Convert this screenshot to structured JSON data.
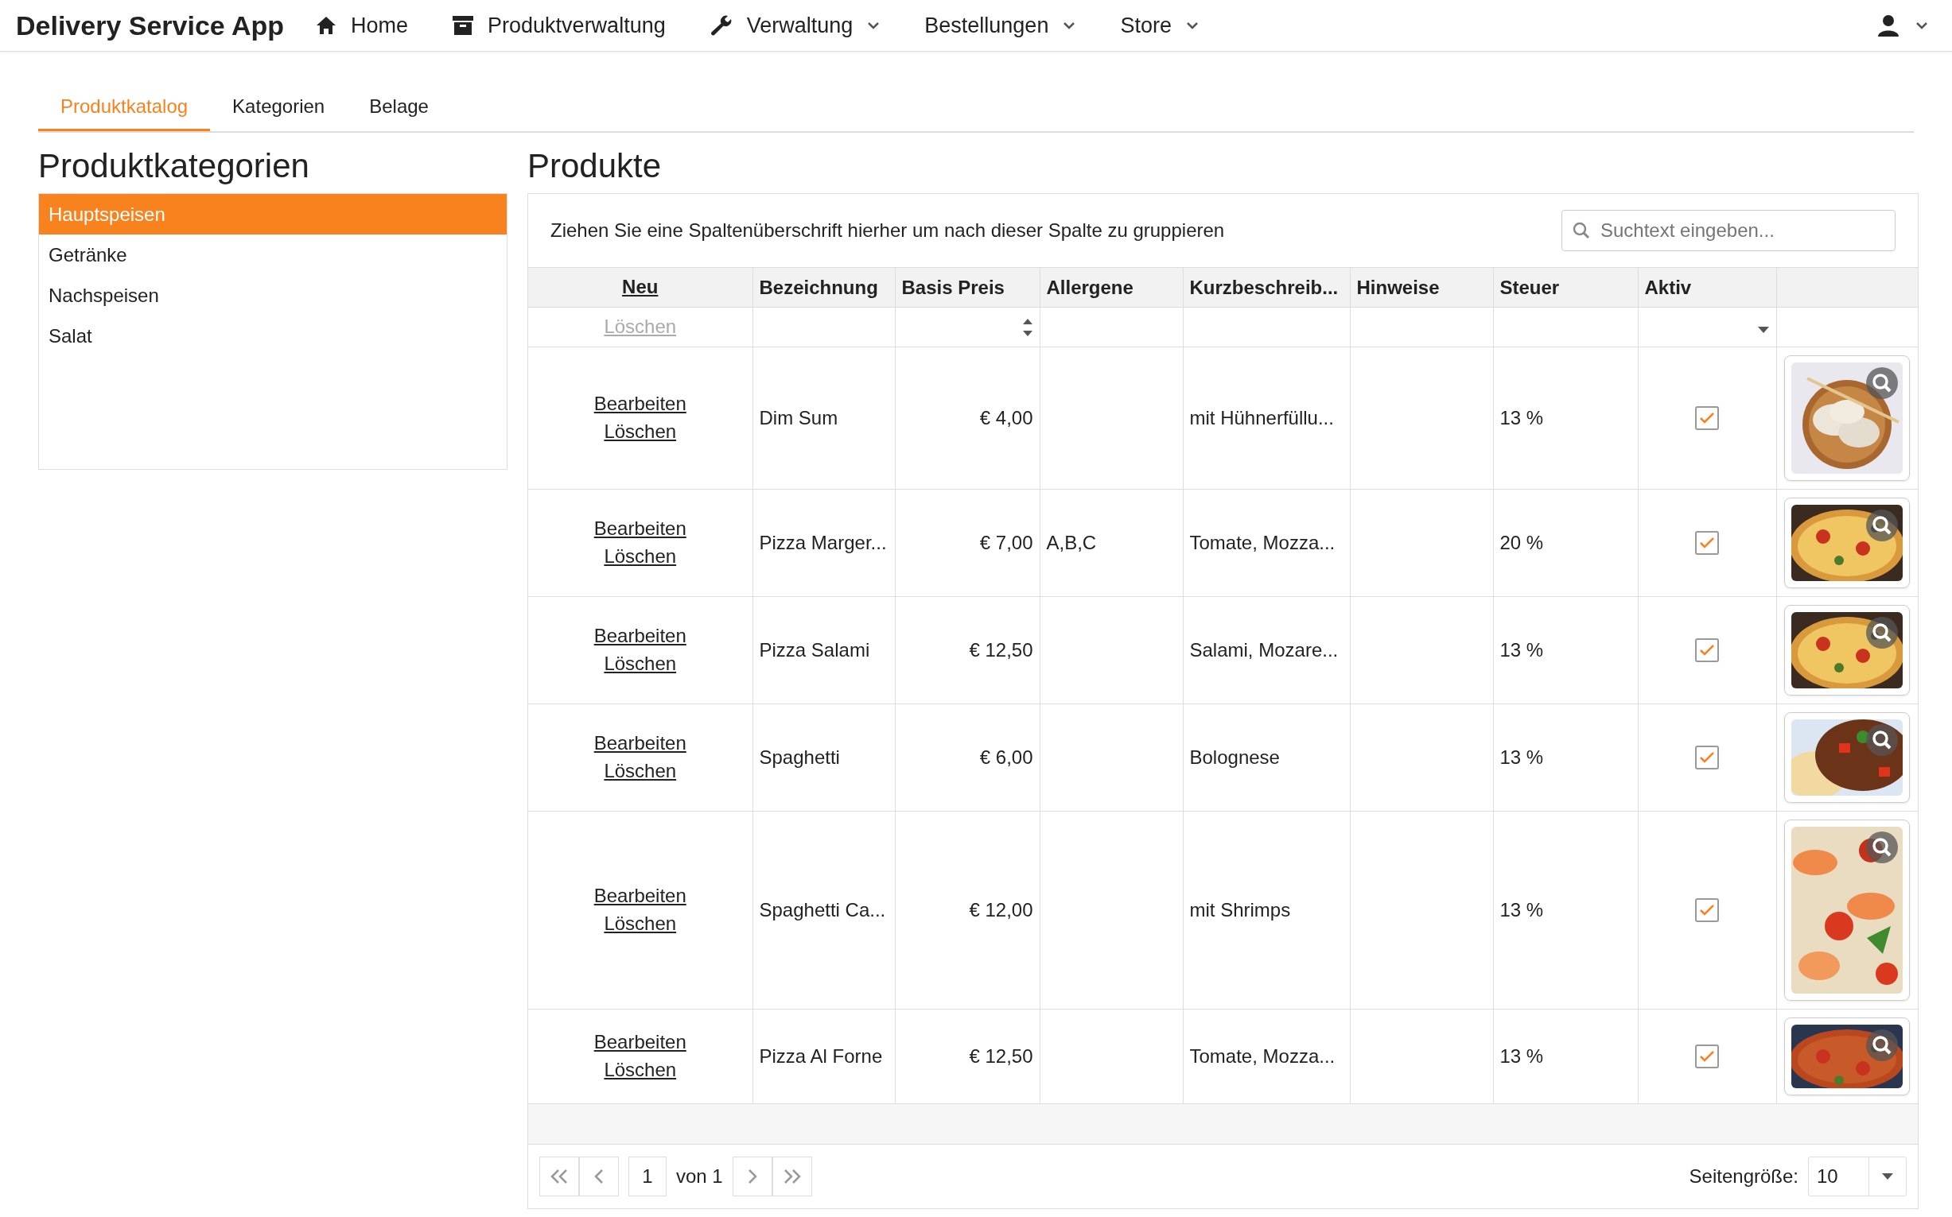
{
  "app_title": "Delivery Service App",
  "nav": [
    {
      "label": "Home",
      "dropdown": false
    },
    {
      "label": "Produktverwaltung",
      "dropdown": false
    },
    {
      "label": "Verwaltung",
      "dropdown": true
    },
    {
      "label": "Bestellungen",
      "dropdown": true
    },
    {
      "label": "Store",
      "dropdown": true
    }
  ],
  "tabs": [
    {
      "label": "Produktkatalog",
      "selected": true
    },
    {
      "label": "Kategorien",
      "selected": false
    },
    {
      "label": "Belage",
      "selected": false
    }
  ],
  "categories": {
    "title": "Produktkategorien",
    "items": [
      {
        "label": "Hauptspeisen",
        "selected": true
      },
      {
        "label": "Getränke",
        "selected": false
      },
      {
        "label": "Nachspeisen",
        "selected": false
      },
      {
        "label": "Salat",
        "selected": false
      }
    ]
  },
  "products": {
    "title": "Produkte",
    "group_hint": "Ziehen Sie eine Spaltenüberschrift hierher um nach dieser Spalte zu gruppieren",
    "search": {
      "placeholder": "Suchtext eingeben..."
    },
    "new_link": "Neu",
    "filter_delete": {
      "label": "Löschen",
      "disabled": true
    },
    "columns": [
      "Bezeichnung",
      "Basis Preis",
      "Allergene",
      "Kurzbeschreib...",
      "Hinweise",
      "Steuer",
      "Aktiv"
    ],
    "rows": [
      {
        "edit": "Bearbeiten",
        "delete": "Löschen",
        "name": "Dim Sum",
        "price": "€ 4,00",
        "description": "mit Hühnerfüllu...",
        "tax": "13 %",
        "active": true
      },
      {
        "edit": "Bearbeiten",
        "delete": "Löschen",
        "name": "Pizza Marger...",
        "price": "€ 7,00",
        "allergens": "A,B,C",
        "description": "Tomate, Mozza...",
        "tax": "20 %",
        "active": true
      },
      {
        "edit": "Bearbeiten",
        "delete": "Löschen",
        "name": "Pizza Salami",
        "price": "€ 12,50",
        "description": "Salami, Mozare...",
        "tax": "13 %",
        "active": true
      },
      {
        "edit": "Bearbeiten",
        "delete": "Löschen",
        "name": "Spaghetti",
        "price": "€ 6,00",
        "description": "Bolognese",
        "tax": "13 %",
        "active": true
      },
      {
        "edit": "Bearbeiten",
        "delete": "Löschen",
        "name": "Spaghetti Ca...",
        "price": "€ 12,00",
        "description": "mit Shrimps",
        "tax": "13 %",
        "active": true
      },
      {
        "edit": "Bearbeiten",
        "delete": "Löschen",
        "name": "Pizza Al Forne",
        "price": "€ 12,50",
        "description": "Tomate, Mozza...",
        "tax": "13 %",
        "active": true
      }
    ],
    "pager": {
      "page": "1",
      "of": "von 1",
      "page_size_label": "Seitengröße:",
      "page_size": "10"
    }
  }
}
